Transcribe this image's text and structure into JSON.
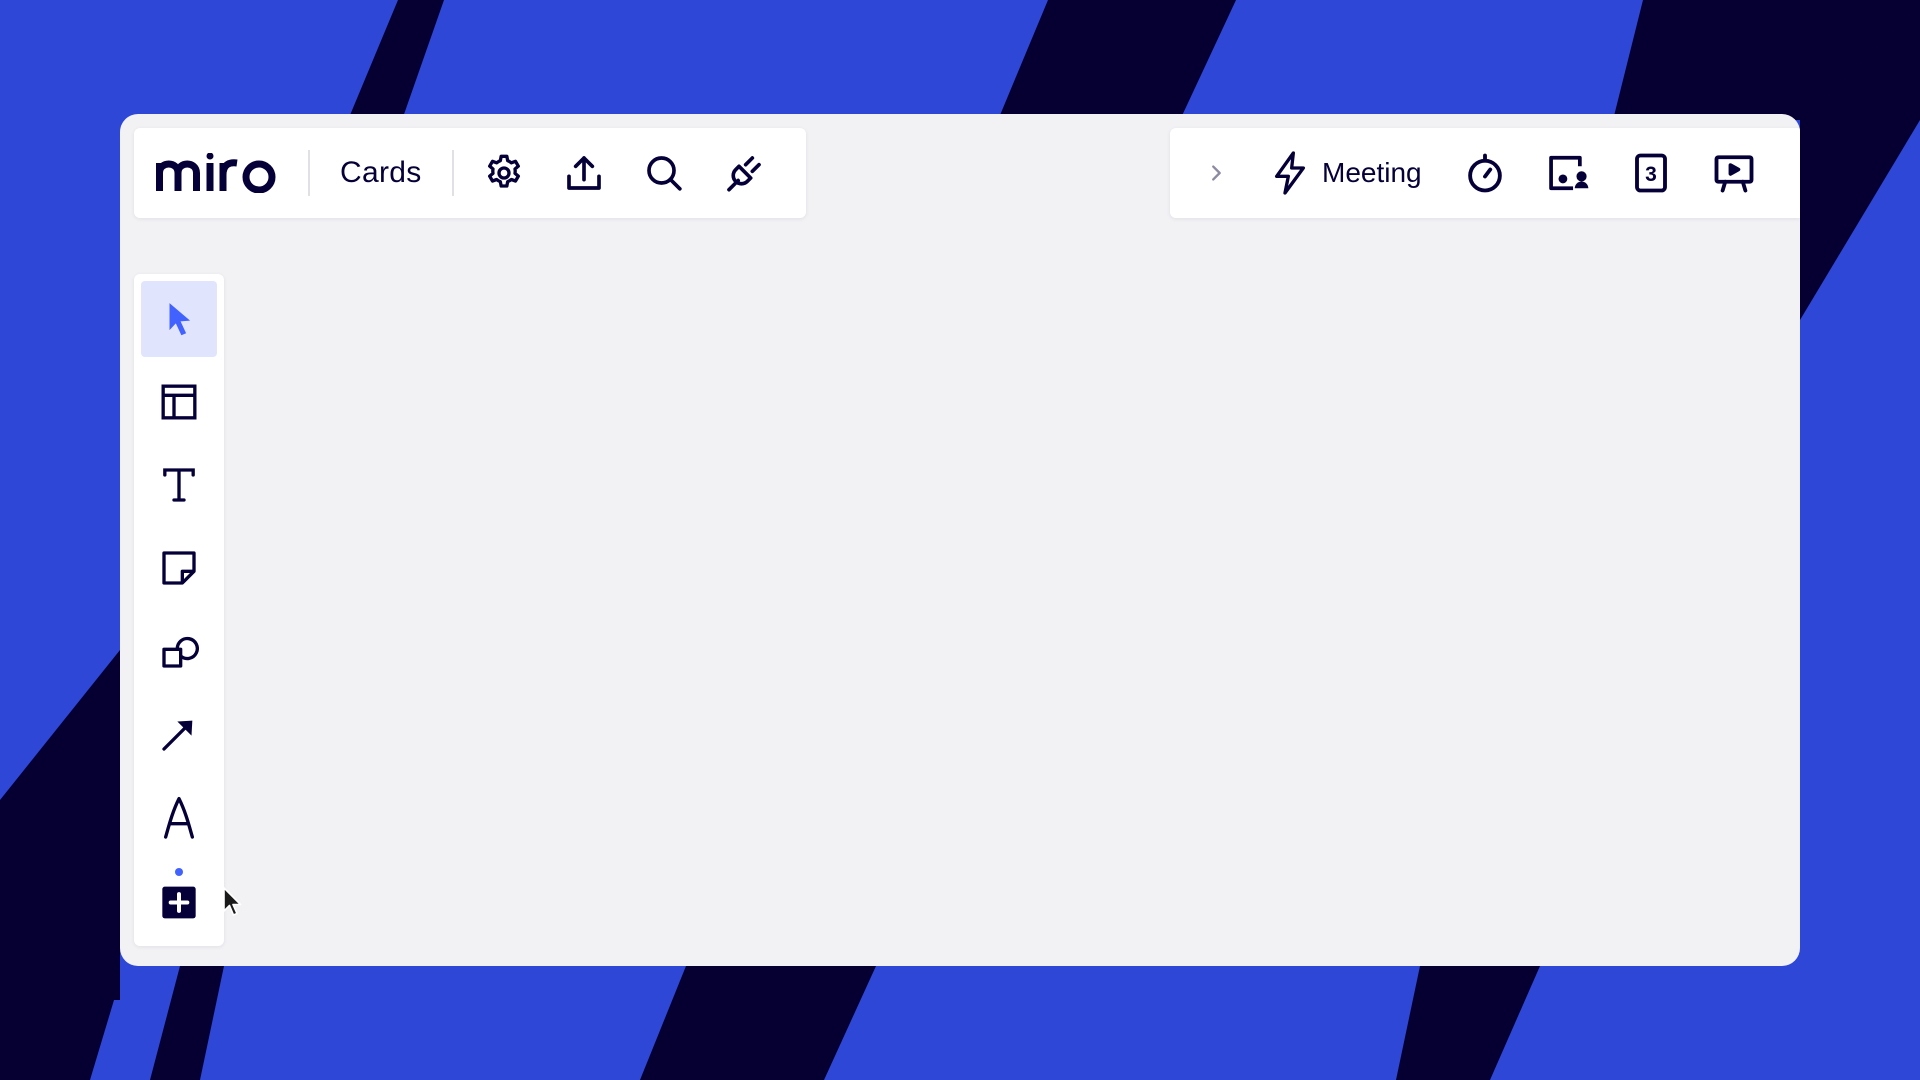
{
  "colors": {
    "background_blue": "#2e47d6",
    "background_navy": "#050031",
    "canvas": "#f2f2f5",
    "toolbar": "#ffffff",
    "ink": "#050038",
    "accent": "#4262ff",
    "active_tool_bg": "#e0e5fd"
  },
  "header": {
    "logo_text": "miro",
    "board_name": "Cards",
    "left_icons": [
      "gear-icon",
      "upload-icon",
      "search-icon",
      "plug-icon"
    ]
  },
  "collab_bar": {
    "meeting_label": "Meeting",
    "icons": [
      "chevron-right-icon",
      "lightning-icon",
      "timer-icon",
      "video-chat-icon",
      "voting-card-icon",
      "presentation-icon"
    ],
    "voting_card_number": "3"
  },
  "left_toolbar": {
    "active_tool": "select",
    "tools": [
      "select",
      "templates",
      "text",
      "sticky-note",
      "shapes",
      "connection-line",
      "pen",
      "more-apps"
    ]
  }
}
